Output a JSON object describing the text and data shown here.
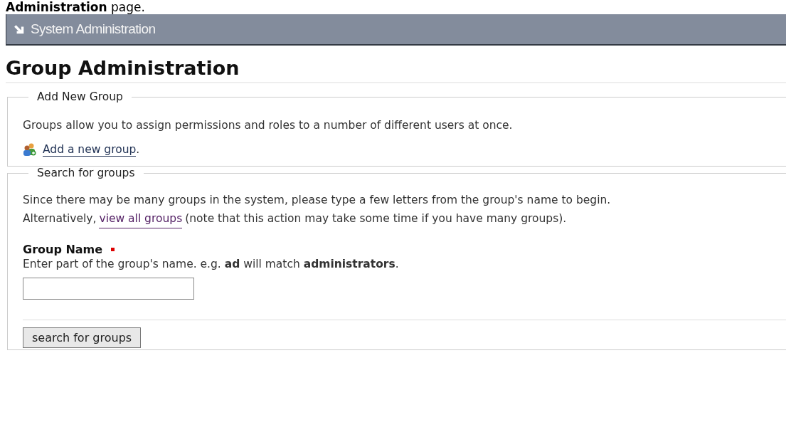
{
  "intro": {
    "text": "**Administration** page."
  },
  "breadcrumb": {
    "label": "System Administration"
  },
  "heading": "Group Administration",
  "add_section": {
    "legend": "Add New Group",
    "description": "Groups allow you to assign permissions and roles to a number of different users at once.",
    "link": "Add a new group",
    "after_link": "."
  },
  "search_section": {
    "legend": "Search for groups",
    "description": "Since there may be many groups in the system, please type a few letters from the group's name to begin.",
    "alt_before": "Alternatively,",
    "alt_link": "view all groups",
    "alt_after": "(note that this action may take some time if you have many groups).",
    "field": {
      "label": "Group Name",
      "required": true,
      "help": "Enter part of the group's name. e.g. **ad** will match **administrators**."
    },
    "button": "search for groups"
  }
}
